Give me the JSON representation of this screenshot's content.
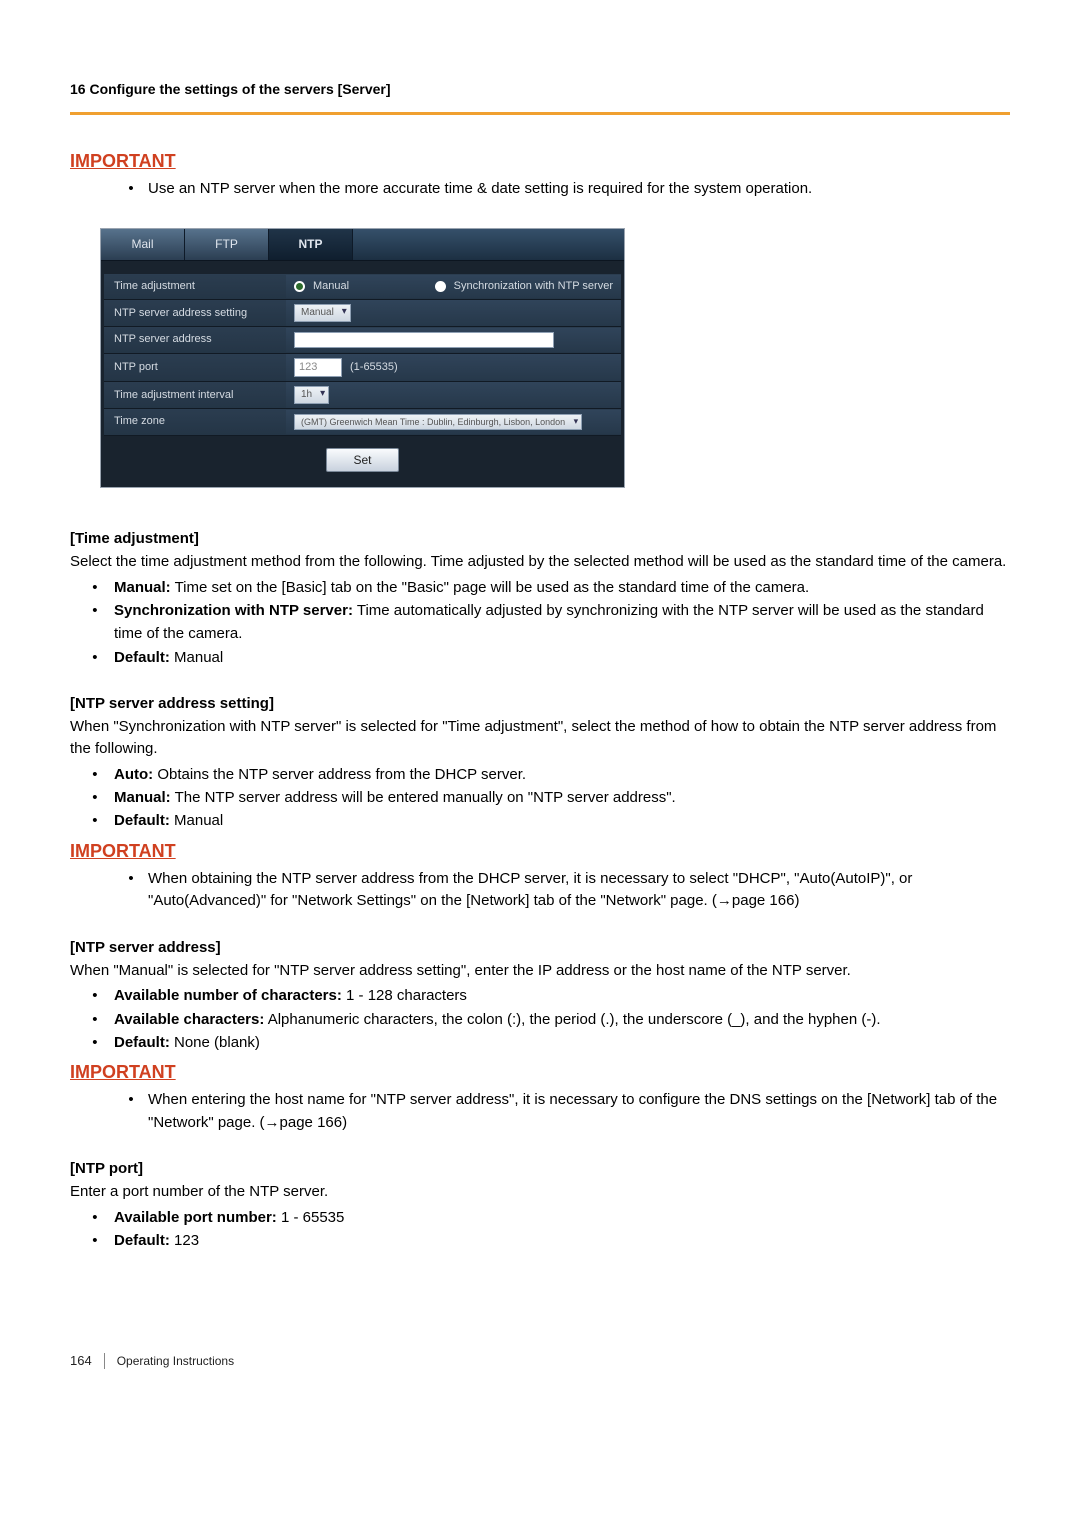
{
  "header": "16 Configure the settings of the servers [Server]",
  "important_label": "IMPORTANT",
  "top_note": "Use an NTP server when the more accurate time & date setting is required for the system operation.",
  "panel": {
    "tabs": {
      "mail": "Mail",
      "ftp": "FTP",
      "ntp": "NTP"
    },
    "row1": {
      "label": "Time adjustment",
      "opt1": "Manual",
      "opt2": "Synchronization with NTP server"
    },
    "row2": {
      "label": "NTP server address setting",
      "sel": "Manual"
    },
    "row3": {
      "label": "NTP server address"
    },
    "row4": {
      "label": "NTP port",
      "val": "123",
      "hint": "(1-65535)"
    },
    "row5": {
      "label": "Time adjustment interval",
      "sel": "1h"
    },
    "row6": {
      "label": "Time zone",
      "sel": "(GMT) Greenwich Mean Time : Dublin, Edinburgh, Lisbon, London"
    },
    "set_btn": "Set"
  },
  "s_time": {
    "head": "[Time adjustment]",
    "intro": "Select the time adjustment method from the following. Time adjusted by the selected method will be used as the standard time of the camera.",
    "i1b": "Manual:",
    "i1t": " Time set on the [Basic] tab on the \"Basic\" page will be used as the standard time of the camera.",
    "i2b": "Synchronization with NTP server:",
    "i2t": " Time automatically adjusted by synchronizing with the NTP server will be used as the standard time of the camera.",
    "i3b": "Default:",
    "i3t": " Manual"
  },
  "s_addrset": {
    "head": "[NTP server address setting]",
    "intro": "When \"Synchronization with NTP server\" is selected for \"Time adjustment\", select the method of how to obtain the NTP server address from the following.",
    "i1b": "Auto:",
    "i1t": " Obtains the NTP server address from the DHCP server.",
    "i2b": "Manual:",
    "i2t": " The NTP server address will be entered manually on \"NTP server address\".",
    "i3b": "Default:",
    "i3t": " Manual"
  },
  "imp2": "When obtaining the NTP server address from the DHCP server, it is necessary to select \"DHCP\", \"Auto(AutoIP)\", or \"Auto(Advanced)\" for \"Network Settings\" on the [Network] tab of the \"Network\" page. (",
  "imp2_xref": "→page 166",
  "imp2_close": ")",
  "s_addr": {
    "head": "[NTP server address]",
    "intro": "When \"Manual\" is selected for \"NTP server address setting\", enter the IP address or the host name of the NTP server.",
    "i1b": "Available number of characters:",
    "i1t": " 1 - 128 characters",
    "i2b": "Available characters:",
    "i2t": " Alphanumeric characters, the colon (:), the period (.), the underscore (_), and the hyphen (-).",
    "i3b": "Default:",
    "i3t": " None (blank)"
  },
  "imp3": "When entering the host name for \"NTP server address\", it is necessary to configure the DNS settings on the [Network] tab of the \"Network\" page. (",
  "imp3_xref": "→page 166",
  "imp3_close": ")",
  "s_port": {
    "head": "[NTP port]",
    "intro": "Enter a port number of the NTP server.",
    "i1b": "Available port number:",
    "i1t": " 1 - 65535",
    "i2b": "Default:",
    "i2t": " 123"
  },
  "footer": {
    "page": "164",
    "label": "Operating Instructions"
  }
}
